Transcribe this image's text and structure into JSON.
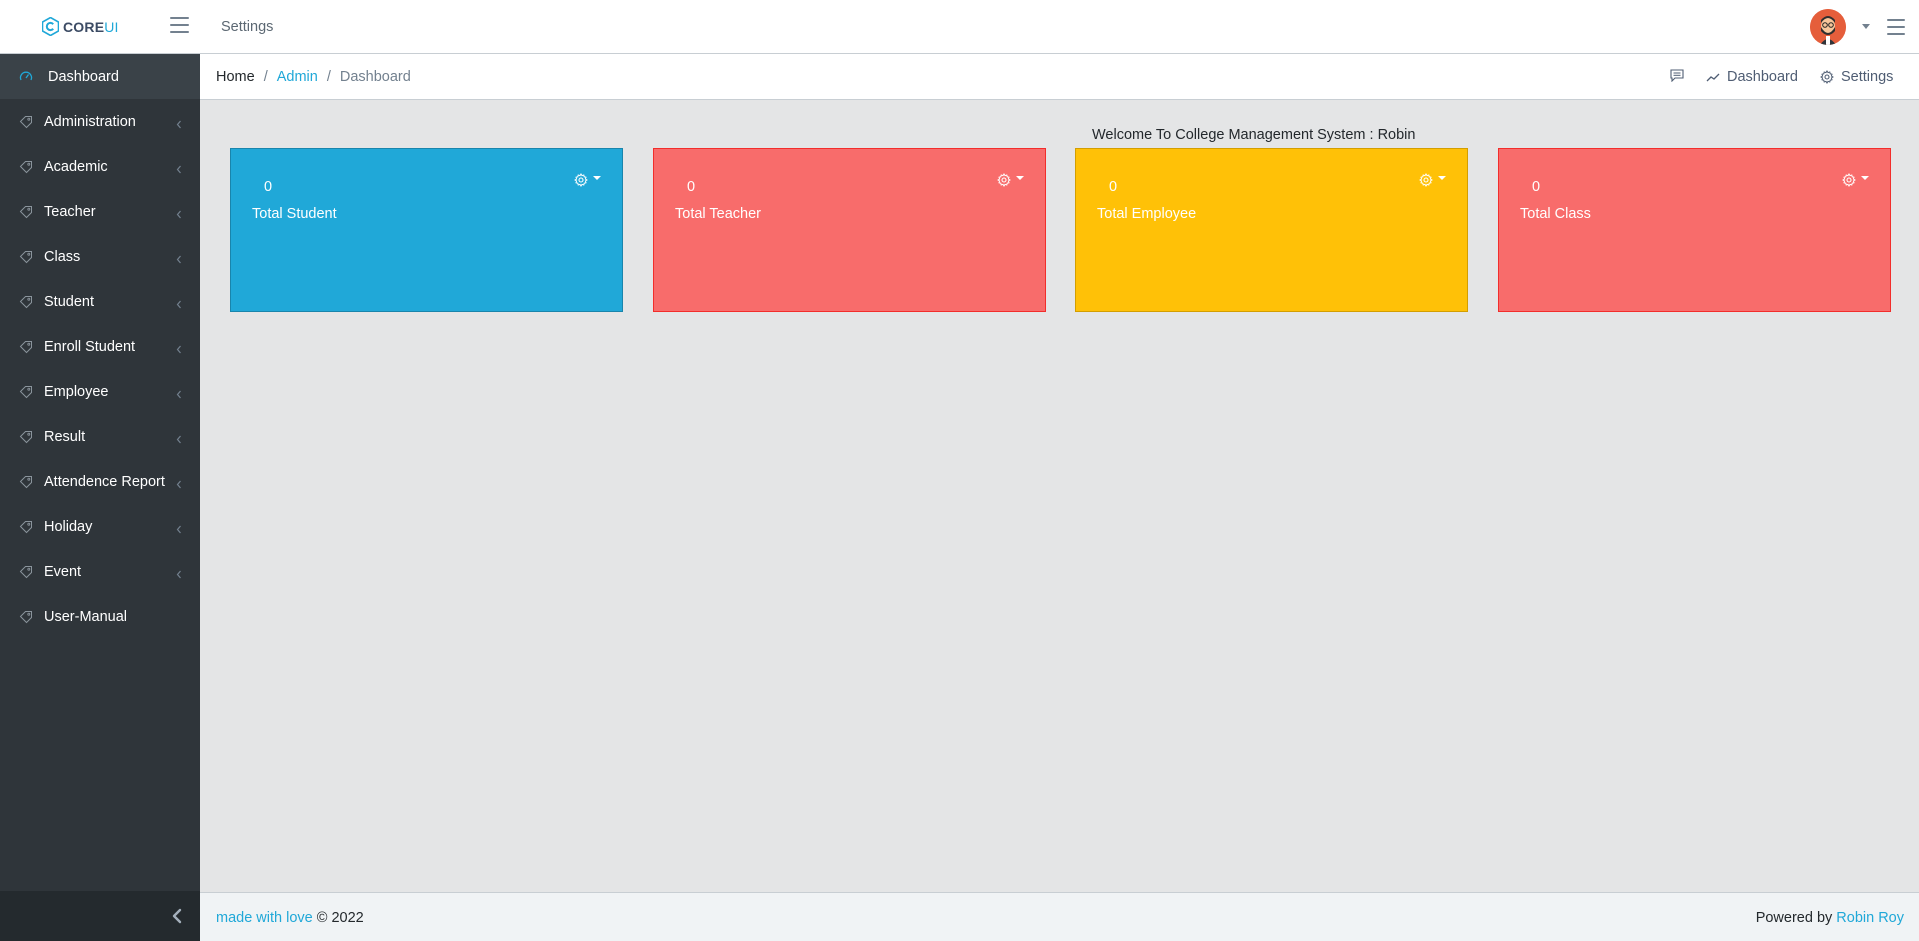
{
  "header": {
    "brand_core": "CORE",
    "brand_ui": "UI",
    "nav_settings": "Settings"
  },
  "sidebar": {
    "items": [
      {
        "label": "Dashboard",
        "active": true,
        "has_submenu": false
      },
      {
        "label": "Administration",
        "has_submenu": true
      },
      {
        "label": "Academic",
        "has_submenu": true
      },
      {
        "label": "Teacher",
        "has_submenu": true
      },
      {
        "label": "Class",
        "has_submenu": true
      },
      {
        "label": "Student",
        "has_submenu": true
      },
      {
        "label": "Enroll Student",
        "has_submenu": true
      },
      {
        "label": "Employee",
        "has_submenu": true
      },
      {
        "label": "Result",
        "has_submenu": true
      },
      {
        "label": "Attendence Report",
        "has_submenu": true
      },
      {
        "label": "Holiday",
        "has_submenu": true
      },
      {
        "label": "Event",
        "has_submenu": true
      },
      {
        "label": "User-Manual",
        "has_submenu": false
      }
    ]
  },
  "breadcrumb": {
    "home": "Home",
    "admin": "Admin",
    "current": "Dashboard",
    "separator": "/",
    "menu_dashboard": "Dashboard",
    "menu_settings": "Settings"
  },
  "main": {
    "welcome": "Welcome To College Management System : Robin",
    "cards": [
      {
        "value": "0",
        "label": "Total Student",
        "color": "#20a8d8"
      },
      {
        "value": "0",
        "label": "Total Teacher",
        "color": "#f86c6b"
      },
      {
        "value": "0",
        "label": "Total Employee",
        "color": "#ffc107"
      },
      {
        "value": "0",
        "label": "Total Class",
        "color": "#f86c6b"
      }
    ]
  },
  "footer": {
    "link": "made with love",
    "copyright": "© 2022",
    "powered_by": "Powered by",
    "author": "Robin Roy"
  },
  "icons": {
    "sidebar_item": "tag-icon",
    "dashboard": "speedometer-icon",
    "card_menu": "gear-icon"
  }
}
